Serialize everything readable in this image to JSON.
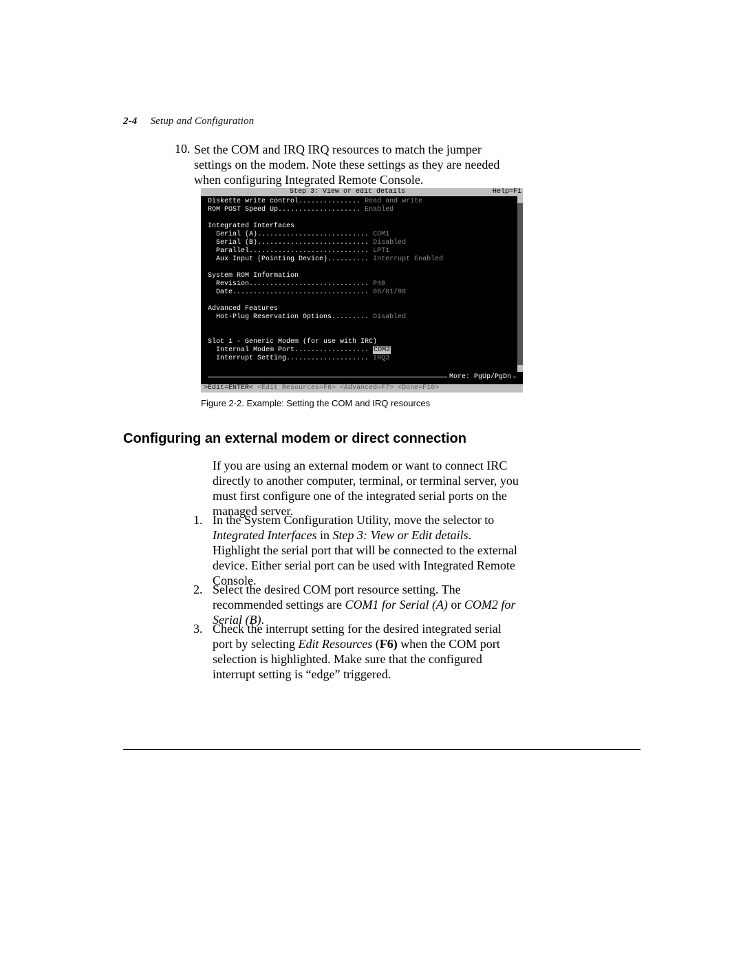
{
  "header": {
    "page_num": "2-4",
    "section": "Setup and Configuration"
  },
  "step10": {
    "number": "10.",
    "text": "Set the COM and IRQ IRQ resources to match the jumper settings on the modem. Note these settings as they are needed when configuring Integrated Remote Console."
  },
  "bios": {
    "title": "Step 3:  View or edit details",
    "help": "Help=F1",
    "line_diskette_label": "Diskette write control...............",
    "line_diskette_val": "Read and write",
    "line_rompost_label": "ROM POST Speed Up....................",
    "line_rompost_val": "Enabled",
    "hdr_interfaces": "Integrated Interfaces",
    "line_serialA_label": "  Serial (A)...........................",
    "line_serialA_val": "COM1",
    "line_serialB_label": "  Serial (B)...........................",
    "line_serialB_val": "Disabled",
    "line_parallel_label": "  Parallel.............................",
    "line_parallel_val": "LPT1",
    "line_aux_label": "  Aux Input (Pointing Device)..........",
    "line_aux_val": "Interrupt Enabled",
    "hdr_sysrom": "System ROM Information",
    "line_rev_label": "  Revision.............................",
    "line_rev_val": "P40",
    "line_date_label": "  Date.................................",
    "line_date_val": "06/01/98",
    "hdr_adv": "Advanced Features",
    "line_hotplug_label": "  Hot-Plug Reservation Options.........",
    "line_hotplug_val": "Disabled",
    "hdr_slot1": "Slot 1 - Generic Modem (for use with IRC)",
    "line_modemport_label": "  Internal Modem Port..................",
    "line_modemport_val": "COM2",
    "line_intset_label": "  Interrupt Setting....................",
    "line_intset_val": "IRQ3",
    "more": "More: PgUp/PgDn",
    "status_edit": ">Edit=ENTER<",
    "status_res": " <Edit Resources=F6>",
    "status_adv": " <Advanced=F7>",
    "status_done": " <Done=F10>"
  },
  "figure": {
    "caption": "Figure 2-2.    Example: Setting the COM and IRQ resources"
  },
  "heading": "Configuring an external modem or direct connection",
  "para1": "If you are using an external modem or want to connect IRC directly to another computer, terminal, or terminal server, you must first configure one of the integrated serial ports   on the managed server.",
  "ol": {
    "n1": "1.",
    "t1a": "In the System Configuration Utility, move the selector to ",
    "t1b": "Integrated Interfaces",
    "t1c": " in ",
    "t1d": "Step 3: View or Edit details",
    "t1e": ". Highlight the serial port that will be connected to the external device. Either serial port can be used with Integrated Remote Console.",
    "n2": "2.",
    "t2a": "Select the desired COM port resource setting. The recommended settings are ",
    "t2b": "COM1 for Serial (A)",
    "t2c": " or ",
    "t2d": "COM2 for Serial (B)",
    "t2e": ".",
    "n3": "3.",
    "t3a": "Check the interrupt setting for the desired integrated serial port by selecting ",
    "t3b": "Edit Resources",
    "t3c": " (",
    "t3d": "F6)",
    "t3e": " when the COM port selection is highlighted. Make sure that the configured interrupt setting is “edge” triggered."
  }
}
